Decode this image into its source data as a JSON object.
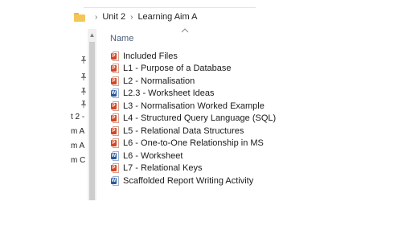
{
  "breadcrumb": {
    "items": [
      "Unit 2",
      "Learning Aim A"
    ]
  },
  "quick_access": {
    "items": [
      "t 2 - ’",
      "m A",
      "m A",
      "m C"
    ]
  },
  "columns": {
    "name_label": "Name"
  },
  "files": [
    {
      "name": "Included Files",
      "type": "ppt"
    },
    {
      "name": "L1 - Purpose of a Database",
      "type": "ppt"
    },
    {
      "name": "L2 - Normalisation",
      "type": "ppt"
    },
    {
      "name": "L2.3 - Worksheet Ideas",
      "type": "word"
    },
    {
      "name": "L3 - Normalisation Worked Example",
      "type": "ppt"
    },
    {
      "name": "L4 - Structured Query Language (SQL)",
      "type": "ppt"
    },
    {
      "name": "L5 - Relational Data Structures",
      "type": "ppt"
    },
    {
      "name": "L6 - One-to-One Relationship in MS",
      "type": "ppt"
    },
    {
      "name": "L6 - Worksheet",
      "type": "word"
    },
    {
      "name": "L7 - Relational Keys",
      "type": "ppt"
    },
    {
      "name": "Scaffolded Report Writing Activity",
      "type": "word"
    }
  ],
  "icons": {
    "ppt_badge": "P",
    "word_badge": "W",
    "pin": "📌",
    "scroll_up": "▲",
    "chevron": "›"
  },
  "colors": {
    "ppt": "#d24726",
    "word": "#2b579a",
    "folder": "#f3c65a",
    "header_text": "#4c607a"
  }
}
